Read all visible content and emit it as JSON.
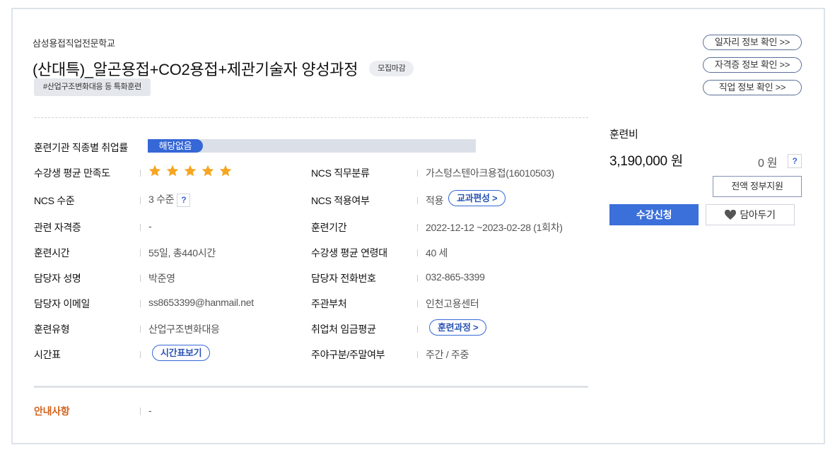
{
  "course": {
    "school": "삼성용접직업전문학교",
    "title": "(산대특)_알곤용접+CO2용접+제관기술자 양성과정",
    "status": "모집마감",
    "tag": "#산업구조변화대응 등 특화훈련"
  },
  "links": {
    "job_info": "일자리 정보 확인 >>",
    "cert_info": "자격증 정보 확인 >>",
    "career_info": "직업 정보 확인 >>"
  },
  "details": {
    "employment_rate_label": "훈련기관 직종별 취업률",
    "employment_rate_value": "해당없음",
    "satisfaction_label": "수강생 평균 만족도",
    "satisfaction_stars": 5,
    "ncs_job_label": "NCS 직무분류",
    "ncs_job_value": "가스텅스텐아크용접(16010503)",
    "ncs_level_label": "NCS 수준",
    "ncs_level_value": "3 수준",
    "ncs_apply_label": "NCS 적용여부",
    "ncs_apply_value": "적용",
    "ncs_apply_button": "교과편성 >",
    "cert_label": "관련 자격증",
    "cert_value": "-",
    "period_label": "훈련기간",
    "period_value": "2022-12-12 ~2023-02-28 (1회차)",
    "hours_label": "훈련시간",
    "hours_value": "55일, 총440시간",
    "age_label": "수강생 평균 연령대",
    "age_value": "40 세",
    "manager_label": "담당자 성명",
    "manager_value": "박준영",
    "phone_label": "담당자 전화번호",
    "phone_value": "032-865-3399",
    "email_label": "담당자 이메일",
    "email_value": "ss8653399@hanmail.net",
    "dept_label": "주관부처",
    "dept_value": "인천고용센터",
    "type_label": "훈련유형",
    "type_value": "산업구조변화대응",
    "wage_label": "취업처 임금평균",
    "wage_button": "훈련과정 >",
    "timetable_label": "시간표",
    "timetable_button": "시간표보기",
    "daynight_label": "주야구분/주말여부",
    "daynight_value": "주간 / 주중",
    "notice_label": "안내사항",
    "notice_value": "-",
    "help_mark": "?"
  },
  "fee": {
    "title": "훈련비",
    "amount": "3,190,000 원",
    "self_pay": "0 원",
    "help_mark": "?",
    "support_label": "전액 정부지원",
    "apply_label": "수강신청",
    "wishlist_label": "담아두기"
  },
  "colors": {
    "accent": "#3b6fd9",
    "star": "#f6a623",
    "notice": "#d4621b"
  }
}
